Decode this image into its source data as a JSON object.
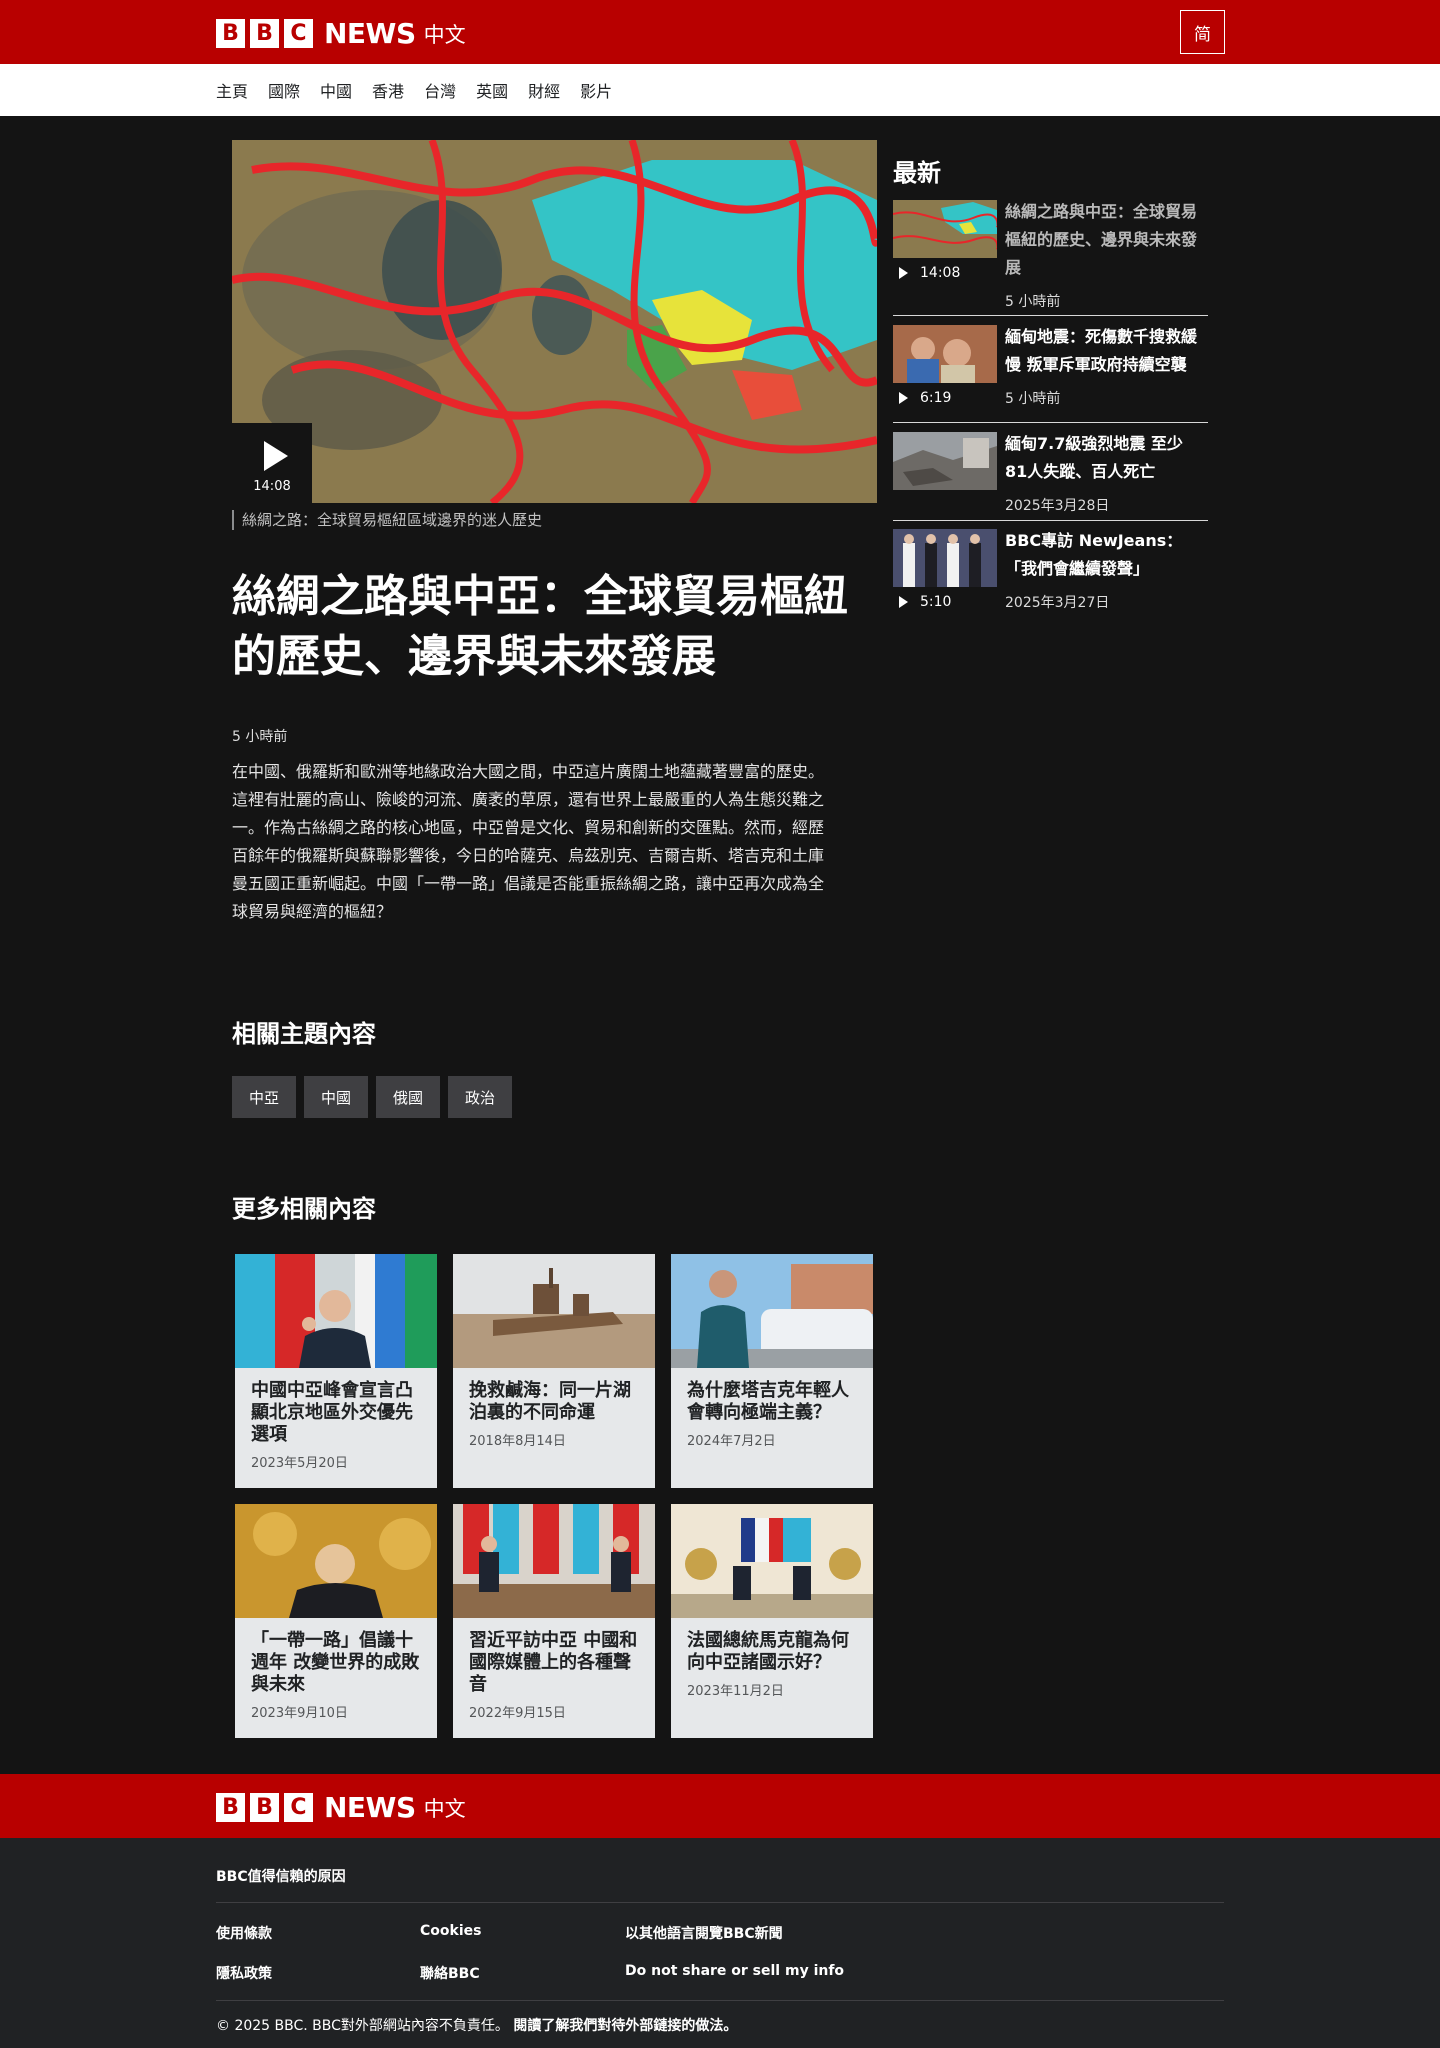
{
  "header": {
    "logo_blocks": [
      "B",
      "B",
      "C"
    ],
    "logo_news": "NEWS",
    "logo_zh": "中文",
    "script_toggle": "简"
  },
  "nav": {
    "items": [
      "主頁",
      "國際",
      "中國",
      "香港",
      "台灣",
      "英國",
      "財經",
      "影片"
    ]
  },
  "article": {
    "video_duration": "14:08",
    "caption": "絲綢之路：全球貿易樞紐區域邊界的迷人歷史",
    "headline": "絲綢之路與中亞：全球貿易樞紐的歷史、邊界與未來發展",
    "time": "5 小時前",
    "summary": "在中國、俄羅斯和歐洲等地緣政治大國之間，中亞這片廣闊土地蘊藏著豐富的歷史。這裡有壯麗的高山、險峻的河流、廣袤的草原，還有世界上最嚴重的人為生態災難之一。作為古絲綢之路的核心地區，中亞曾是文化、貿易和創新的交匯點。然而，經歷百餘年的俄羅斯與蘇聯影響後，今日的哈薩克、烏茲別克、吉爾吉斯、塔吉克和土庫曼五國正重新崛起。中國「一帶一路」倡議是否能重振絲綢之路，讓中亞再次成為全球貿易與經濟的樞紐？"
  },
  "topics": {
    "title": "相關主題內容",
    "tags": [
      "中亞",
      "中國",
      "俄國",
      "政治"
    ]
  },
  "more": {
    "title": "更多相關內容",
    "cards": [
      {
        "title": "中國中亞峰會宣言凸顯北京地區外交優先選項",
        "date": "2023年5月20日"
      },
      {
        "title": "挽救鹹海：同一片湖泊裏的不同命運",
        "date": "2018年8月14日"
      },
      {
        "title": "為什麼塔吉克年輕人會轉向極端主義？",
        "date": "2024年7月2日"
      },
      {
        "title": "「一帶一路」倡議十週年 改變世界的成敗與未來",
        "date": "2023年9月10日"
      },
      {
        "title": "習近平訪中亞 中國和國際媒體上的各種聲音",
        "date": "2022年9月15日"
      },
      {
        "title": "法國總統馬克龍為何向中亞諸國示好？",
        "date": "2023年11月2日"
      }
    ]
  },
  "latest": {
    "title": "最新",
    "items": [
      {
        "title": "絲綢之路與中亞：全球貿易樞紐的歷史、邊界與未來發展",
        "time": "5 小時前",
        "duration": "14:08"
      },
      {
        "title": "緬甸地震：死傷數千搜救緩慢 叛軍斥軍政府持續空襲",
        "time": "5 小時前",
        "duration": "6:19"
      },
      {
        "title": "緬甸7.7級強烈地震 至少81人失蹤、百人死亡",
        "time": "2025年3月28日",
        "duration": ""
      },
      {
        "title": "BBC專訪 NewJeans：「我們會繼續發聲」",
        "time": "2025年3月27日",
        "duration": "5:10"
      }
    ]
  },
  "footer": {
    "trust": "BBC值得信賴的原因",
    "links": [
      "使用條款",
      "Cookies",
      "以其他語言閱覽BBC新聞",
      "隱私政策",
      "聯絡BBC",
      "Do not share or sell my info"
    ],
    "copyright": "© 2025 BBC. BBC對外部網站內容不負責任。",
    "external_link": "閱讀了解我們對待外部鏈接的做法。"
  },
  "colors": {
    "brand_red": "#b80000",
    "page_bg": "#141414",
    "footer_bg": "#202224",
    "card_bg": "#e6e8ea"
  }
}
